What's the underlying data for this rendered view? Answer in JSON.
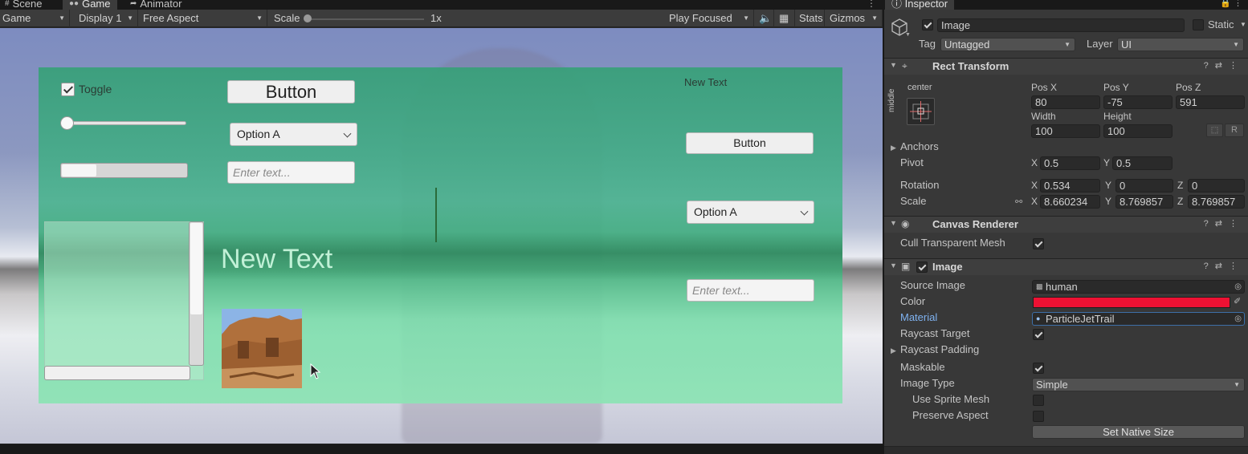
{
  "tabs": {
    "scene": "Scene",
    "game": "Game",
    "animator": "Animator"
  },
  "game_toolbar": {
    "display_mode": "Game",
    "display": "Display 1",
    "aspect": "Free Aspect",
    "scale_label": "Scale",
    "scale_value": "1x",
    "play_mode": "Play Focused",
    "stats": "Stats",
    "gizmos": "Gizmos"
  },
  "game_ui": {
    "toggle_label": "Toggle",
    "button_large": "Button",
    "button_small": "Button",
    "dropdown_a": "Option A",
    "dropdown_b": "Option A",
    "input_a_placeholder": "Enter text...",
    "input_b_placeholder": "Enter text...",
    "text_big": "New Text",
    "text_small": "New Text",
    "slider_value": 0.0,
    "scrollbar_size": 0.28
  },
  "inspector": {
    "tab": "Inspector",
    "object_name": "Image",
    "object_active": true,
    "static_label": "Static",
    "tag_label": "Tag",
    "tag_value": "Untagged",
    "layer_label": "Layer",
    "layer_value": "UI",
    "rect_transform": {
      "title": "Rect Transform",
      "anchor_h": "center",
      "anchor_v": "middle",
      "pos_x_label": "Pos X",
      "pos_x": "80",
      "pos_y_label": "Pos Y",
      "pos_y": "-75",
      "pos_z_label": "Pos Z",
      "pos_z": "591",
      "width_label": "Width",
      "width": "100",
      "height_label": "Height",
      "height": "100",
      "r_button": "R",
      "anchors_label": "Anchors",
      "pivot_label": "Pivot",
      "pivot_x": "0.5",
      "pivot_y": "0.5",
      "rotation_label": "Rotation",
      "rot_x": "0.534",
      "rot_y": "0",
      "rot_z": "0",
      "scale_label": "Scale",
      "scale_x": "8.660234",
      "scale_y": "8.769857",
      "scale_z": "8.769857",
      "x_label": "X",
      "y_label": "Y",
      "z_label": "Z"
    },
    "canvas_renderer": {
      "title": "Canvas Renderer",
      "cull_label": "Cull Transparent Mesh",
      "cull_value": true
    },
    "image": {
      "title": "Image",
      "enabled": true,
      "source_image_label": "Source Image",
      "source_image": "human",
      "color_label": "Color",
      "color": "#ee1133",
      "material_label": "Material",
      "material": "ParticleJetTrail",
      "raycast_target_label": "Raycast Target",
      "raycast_target": true,
      "raycast_padding_label": "Raycast Padding",
      "maskable_label": "Maskable",
      "maskable": true,
      "image_type_label": "Image Type",
      "image_type": "Simple",
      "use_sprite_mesh_label": "Use Sprite Mesh",
      "use_sprite_mesh": false,
      "preserve_aspect_label": "Preserve Aspect",
      "preserve_aspect": false,
      "set_native_size": "Set Native Size"
    }
  },
  "colors": {
    "accent_material_label": "#7fb2f0",
    "canvas_green": "#4fb88a"
  }
}
